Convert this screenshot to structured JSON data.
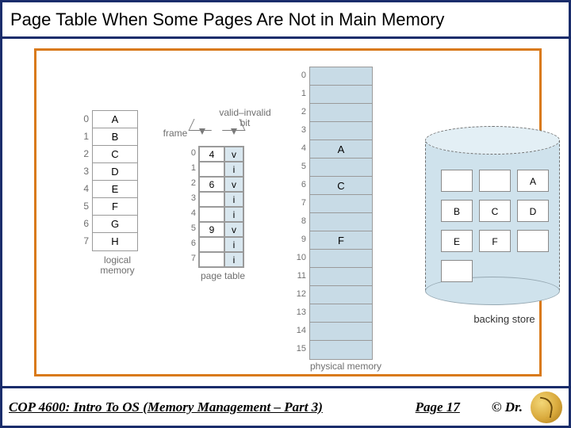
{
  "title": "Page Table When Some Pages Are Not in Main Memory",
  "footer": {
    "course": "COP 4600: Intro To OS  (Memory Management – Part 3)",
    "page": "Page 17",
    "copyright": "© Dr."
  },
  "labels": {
    "logical_memory": "logical\nmemory",
    "page_table": "page table",
    "physical_memory": "physical memory",
    "backing_store": "backing store",
    "frame": "frame",
    "valid_invalid_bit": "valid–invalid\nbit"
  },
  "logical_memory": {
    "indices": [
      "0",
      "1",
      "2",
      "3",
      "4",
      "5",
      "6",
      "7"
    ],
    "pages": [
      "A",
      "B",
      "C",
      "D",
      "E",
      "F",
      "G",
      "H"
    ]
  },
  "page_table": {
    "indices": [
      "0",
      "1",
      "2",
      "3",
      "4",
      "5",
      "6",
      "7"
    ],
    "rows": [
      {
        "frame": "4",
        "bit": "v"
      },
      {
        "frame": "",
        "bit": "i"
      },
      {
        "frame": "6",
        "bit": "v"
      },
      {
        "frame": "",
        "bit": "i"
      },
      {
        "frame": "",
        "bit": "i"
      },
      {
        "frame": "9",
        "bit": "v"
      },
      {
        "frame": "",
        "bit": "i"
      },
      {
        "frame": "",
        "bit": "i"
      }
    ]
  },
  "physical_memory": {
    "indices": [
      "0",
      "1",
      "2",
      "3",
      "4",
      "5",
      "6",
      "7",
      "8",
      "9",
      "10",
      "11",
      "12",
      "13",
      "14",
      "15"
    ],
    "frames": [
      "",
      "",
      "",
      "",
      "A",
      "",
      "C",
      "",
      "",
      "F",
      "",
      "",
      "",
      "",
      "",
      ""
    ]
  },
  "backing_store": {
    "cells": [
      "",
      "",
      "A",
      "B",
      "C",
      "D",
      "E",
      "F",
      "",
      ""
    ]
  }
}
